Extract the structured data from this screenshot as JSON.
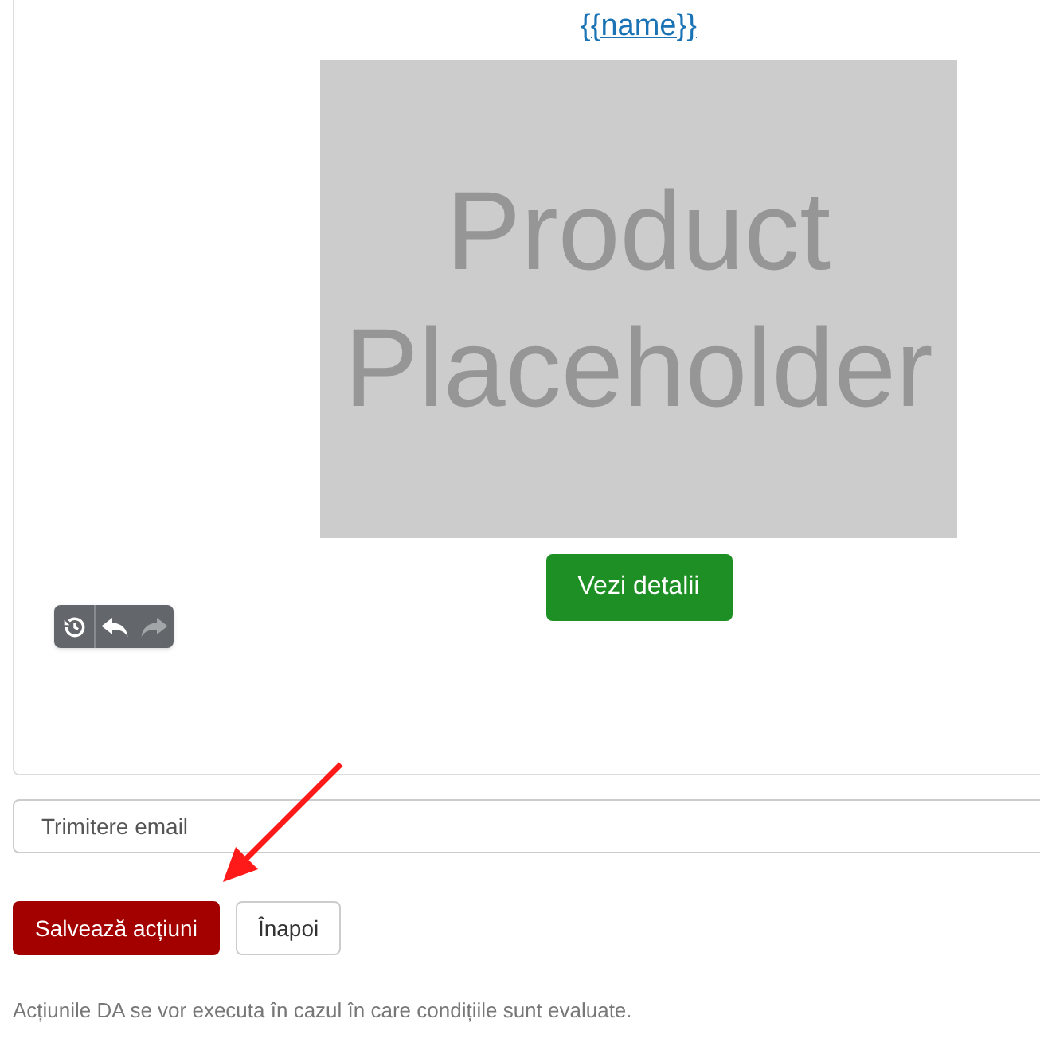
{
  "editor": {
    "product_link": "{{name}}",
    "image_text": [
      "Product",
      "Placeholder"
    ],
    "details_button": "Vezi detalii",
    "toolbar": [
      {
        "kind": "history",
        "disabled": false
      },
      {
        "kind": "undo",
        "disabled": false
      },
      {
        "kind": "redo",
        "disabled": true
      }
    ]
  },
  "action_field": {
    "value": "Trimitere email"
  },
  "buttons": [
    {
      "label": "Salvează acțiuni",
      "kind": "primary"
    },
    {
      "label": "Înapoi",
      "kind": "default"
    }
  ],
  "note": "Acțiunile DA se vor executa în cazul în care condițiile sunt evaluate."
}
